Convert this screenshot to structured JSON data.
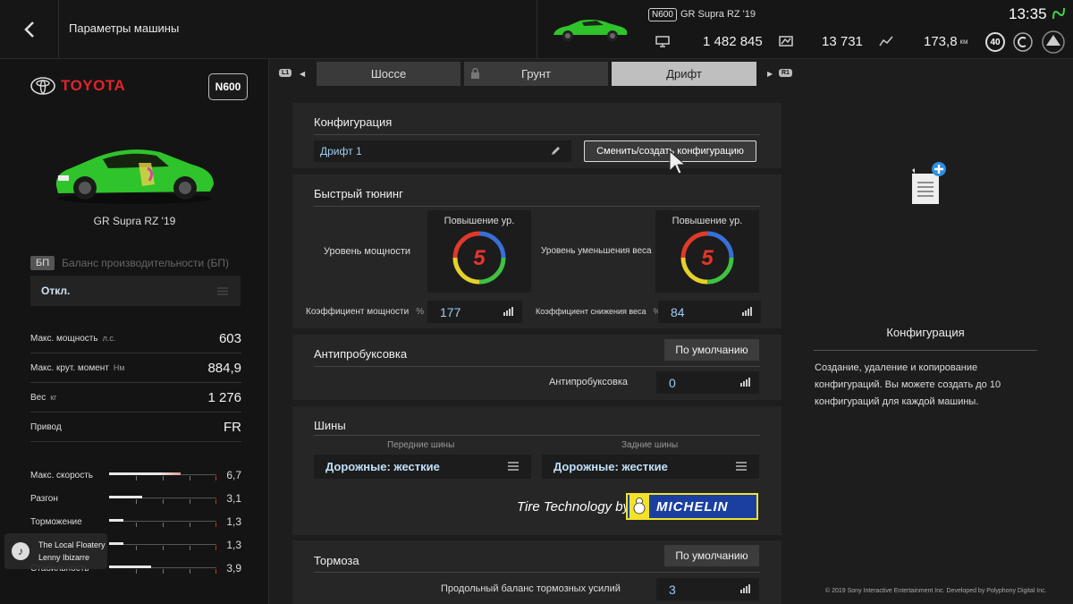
{
  "header": {
    "title": "Параметры машины",
    "car_badge": "N600",
    "car_name": "GR Supra RZ '19",
    "credits": "1 482 845",
    "mileage_points": "13 731",
    "distance": "173,8",
    "distance_unit": "км",
    "level": "40",
    "clock": "13:35"
  },
  "left": {
    "brand": "TOYOTA",
    "pp_badge": "N600",
    "car_name": "GR Supra RZ '19",
    "bp_tag": "БП",
    "bp_label": "Баланс производительности (БП)",
    "bp_value": "Откл.",
    "specs": [
      {
        "label": "Макс. мощность",
        "unit": "л.с.",
        "value": "603"
      },
      {
        "label": "Макс. крут. момент",
        "unit": "Нм",
        "value": "884,9"
      },
      {
        "label": "Вес",
        "unit": "кг",
        "value": "1 276"
      },
      {
        "label": "Привод",
        "unit": "",
        "value": "FR"
      }
    ],
    "performance": [
      {
        "label": "Макс. скорость",
        "value": "6,7",
        "level": 0.67
      },
      {
        "label": "Разгон",
        "value": "3,1",
        "level": 0.31
      },
      {
        "label": "Торможение",
        "value": "1,3",
        "level": 0.13
      },
      {
        "label": "",
        "value": "1,3",
        "level": 0.13
      },
      {
        "label": "Стабильность",
        "value": "3,9",
        "level": 0.39
      }
    ],
    "music": {
      "track": "The Local Floatery",
      "artist": "Lenny Ibizarre"
    }
  },
  "tabs": {
    "left_button": "L1",
    "right_button": "R1",
    "items": [
      {
        "label": "Шоссе"
      },
      {
        "label": "Грунт"
      },
      {
        "label": "Дрифт"
      }
    ]
  },
  "config": {
    "title": "Конфигурация",
    "current": "Дрифт 1",
    "change_button": "Сменить/создать конфигурацию"
  },
  "quick_tuning": {
    "title": "Быстрый тюнинг",
    "power_label": "Уровень мощности",
    "weight_label": "Уровень уменьшения веса",
    "upgrade_label": "Повышение ур.",
    "power_level": "5",
    "weight_level": "5",
    "power_coef_label": "Коэффициент мощности",
    "weight_coef_label": "Коэффициент снижения веса",
    "percent": "%",
    "power_coef": "177",
    "weight_coef": "84"
  },
  "traction": {
    "title": "Антипробуксовка",
    "default_button": "По умолчанию",
    "label": "Антипробуксовка",
    "value": "0"
  },
  "tyres": {
    "title": "Шины",
    "front_label": "Передние шины",
    "rear_label": "Задние шины",
    "front_value": "Дорожные: жесткие",
    "rear_value": "Дорожные: жесткие",
    "tech_text": "Tire Technology by",
    "brand": "MICHELIN"
  },
  "brakes": {
    "title": "Тормоза",
    "default_button": "По умолчанию",
    "label": "Продольный баланс тормозных усилий",
    "value": "3"
  },
  "info": {
    "title": "Конфигурация",
    "description": "Создание, удаление и копирование конфигураций. Вы можете создать до 10 конфигураций для каждой машины."
  },
  "footer": {
    "copyright": "© 2019 Sony Interactive Entertainment Inc. Developed by Polyphony Digital Inc."
  },
  "colors": {
    "accent_red": "#e0242a",
    "value_blue": "#9ecbf0",
    "car_green": "#2fc42b"
  }
}
